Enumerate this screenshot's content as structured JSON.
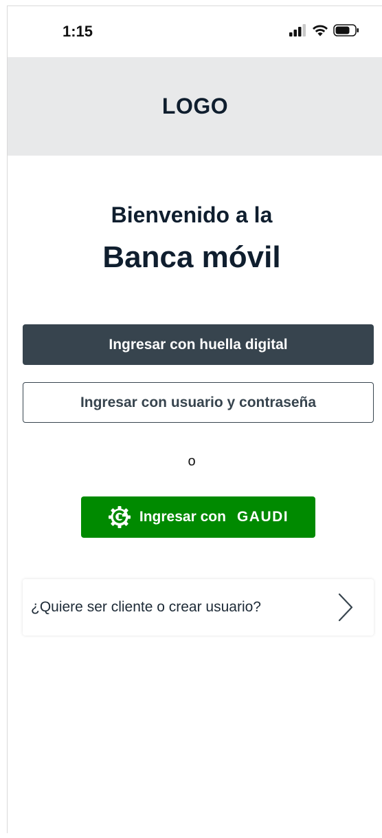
{
  "status_bar": {
    "time": "1:15"
  },
  "header": {
    "logo": "LOGO"
  },
  "welcome": {
    "line1": "Bienvenido a la",
    "line2": "Banca móvil"
  },
  "actions": {
    "fingerprint_label": "Ingresar con huella digital",
    "user_pass_label": "Ingresar con usuario y contraseña",
    "or_label": "o",
    "gaudi_label": "Ingresar con",
    "gaudi_brand": "GAUDI"
  },
  "client_card": {
    "label": "¿Quiere ser cliente o crear usuario?"
  },
  "colors": {
    "primary_dark": "#37444e",
    "gaudi_green": "#008a00",
    "header_gray": "#e8e9ea",
    "text_dark": "#0f1e2e"
  },
  "icons": [
    "signal-icon",
    "wifi-icon",
    "battery-icon",
    "gaudi-g-icon",
    "chevron-right-icon"
  ]
}
